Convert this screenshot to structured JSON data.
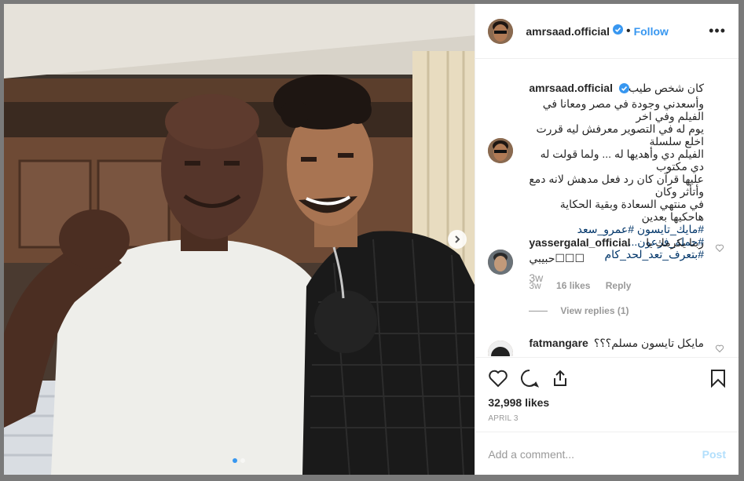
{
  "header": {
    "username": "amrsaad.official",
    "follow_label": "Follow",
    "separator": "•",
    "more_label": "•••"
  },
  "caption": {
    "username": "amrsaad.official",
    "lines": [
      "كان شخص طيب",
      "وأسعدني وجودة في مصر ومعانا في الفيلم وفي اخر",
      "يوم له في التصوير معرفش ليه قررت اخلع سلسلة",
      "الفيلم دي وأهديها له ... ولما قولت له دي مكتوب",
      "عليها قرآن كان رد فعل مدهش لانه دمع وأتأثر وكان",
      "في منتهي السعادة وبقية الحكاية هاحكيها بعدين"
    ],
    "hashtags_line1": "#مايك_تايسون #عمرو_سعد #حملة_فرعون...",
    "hashtags_line2": "#بتعرف_تعد_لحد_كام",
    "time": "3w"
  },
  "comments": [
    {
      "username": "yassergalal_official",
      "text_line1": "ربنا يكرمك يا",
      "text_line2": "حبيبي☐☐☐",
      "time": "3w",
      "likes": "16 likes",
      "reply": "Reply",
      "view_replies": "View replies (1)"
    },
    {
      "username": "fatmangare",
      "text_line1": "مايكل تايسون مسلم؟؟؟"
    }
  ],
  "likes_count": "32,998 likes",
  "post_date": "APRIL 3",
  "add_comment_placeholder": "Add a comment...",
  "post_label": "Post",
  "colors": {
    "accent": "#3897f0",
    "text": "#262626",
    "muted": "#999999",
    "hashtag": "#003569"
  },
  "icons": [
    "verified-badge-icon",
    "heart-icon",
    "comment-icon",
    "share-icon",
    "bookmark-icon",
    "chevron-right-icon"
  ]
}
